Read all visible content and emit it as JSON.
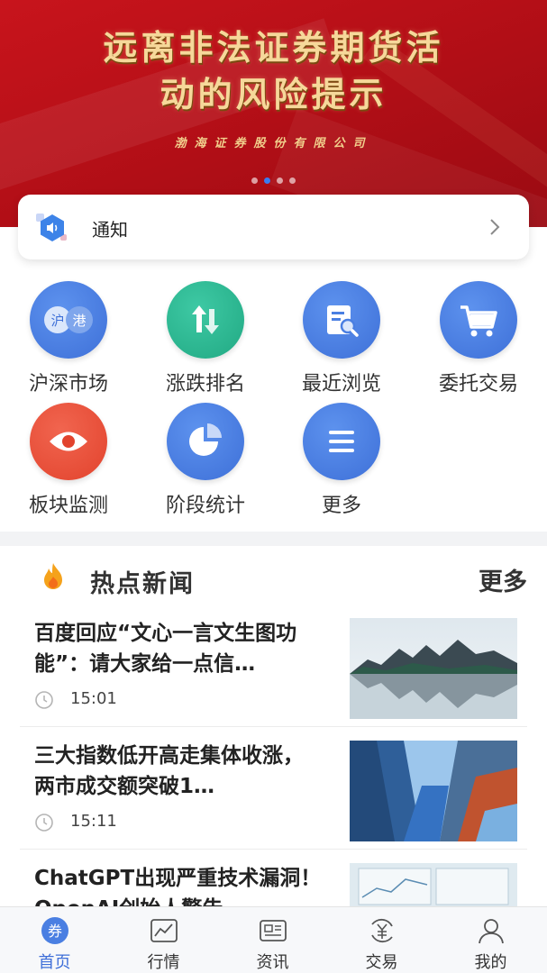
{
  "banner": {
    "title_line1": "远离非法证券期货活",
    "title_line2": "动的风险提示",
    "company": "渤海证券股份有限公司",
    "slide_count": 4,
    "active_slide": 2
  },
  "notice": {
    "label": "通知"
  },
  "quick_menu": [
    {
      "label": "沪深市场",
      "icon": "shanghai-shenzhen-hk-icon",
      "color": "#4a7fe2"
    },
    {
      "label": "涨跌排名",
      "icon": "up-down-arrows-icon",
      "color": "#2bb890"
    },
    {
      "label": "最近浏览",
      "icon": "browse-history-icon",
      "color": "#4a7fe2"
    },
    {
      "label": "委托交易",
      "icon": "shopping-cart-icon",
      "color": "#4a7fe2"
    },
    {
      "label": "板块监测",
      "icon": "eye-icon",
      "color": "#e8503a"
    },
    {
      "label": "阶段统计",
      "icon": "pie-chart-icon",
      "color": "#4a7fe2"
    },
    {
      "label": "更多",
      "icon": "menu-icon",
      "color": "#4a7fe2"
    }
  ],
  "quick_menu_badges": {
    "hu": "沪",
    "gang": "港"
  },
  "hot_news": {
    "title": "热点新闻",
    "more": "更多",
    "items": [
      {
        "title": "百度回应“文心一言文生图功能”：请大家给一点信…",
        "time": "15:01",
        "thumb": "lake-mountain-reflection"
      },
      {
        "title": "三大指数低开高走集体收涨，两市成交额突破1…",
        "time": "15:11",
        "thumb": "skyscrapers"
      },
      {
        "title": "ChatGPT出现严重技术漏洞！OpenAI创始人警告",
        "time": "",
        "thumb": "financial-dashboard"
      }
    ]
  },
  "tabbar": [
    {
      "label": "首页",
      "icon": "home-coupon-icon",
      "active": true
    },
    {
      "label": "行情",
      "icon": "market-chart-icon",
      "active": false
    },
    {
      "label": "资讯",
      "icon": "news-icon",
      "active": false
    },
    {
      "label": "交易",
      "icon": "yuan-exchange-icon",
      "active": false
    },
    {
      "label": "我的",
      "icon": "user-icon",
      "active": false
    }
  ],
  "tab_home_glyph": "券",
  "colors": {
    "accent": "#3f6fd8",
    "banner_red": "#c8141c",
    "gold": "#f6d89a"
  }
}
